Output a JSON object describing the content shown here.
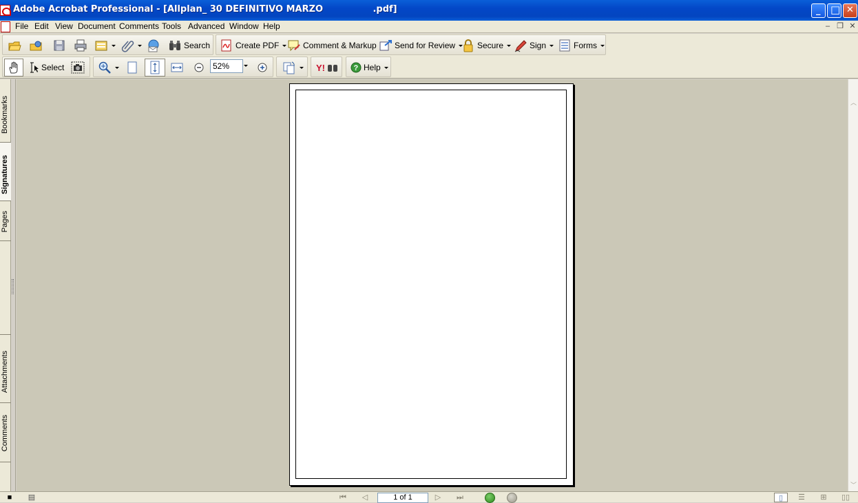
{
  "window": {
    "title": "Adobe Acrobat Professional - [Allplan_ 30 DEFINITIVO MARZO                .pdf]",
    "minimize_glyph": "_",
    "maximize_glyph": "□",
    "close_glyph": "✕"
  },
  "menu": {
    "items": [
      "File",
      "Edit",
      "View",
      "Document",
      "Comments",
      "Tools",
      "Advanced",
      "Window",
      "Help"
    ],
    "mdi_minimize": "–",
    "mdi_restore": "❐",
    "mdi_close": "✕"
  },
  "toolbar1": {
    "search_label": "Search",
    "create_pdf_label": "Create PDF",
    "comment_markup_label": "Comment & Markup",
    "send_review_label": "Send for Review",
    "secure_label": "Secure",
    "sign_label": "Sign",
    "forms_label": "Forms"
  },
  "toolbar2": {
    "select_label": "Select",
    "zoom_value": "52%",
    "help_label": "Help"
  },
  "navigation_panel": {
    "tabs": [
      "Bookmarks",
      "Signatures",
      "Pages",
      "Attachments",
      "Comments"
    ],
    "active_tab": "Signatures"
  },
  "statusbar": {
    "page_indicator": "1 of 1"
  },
  "colors": {
    "titlebar": "#0347c7",
    "chrome": "#ece9d8",
    "document_background": "#cbc8b7",
    "page": "#ffffff"
  }
}
